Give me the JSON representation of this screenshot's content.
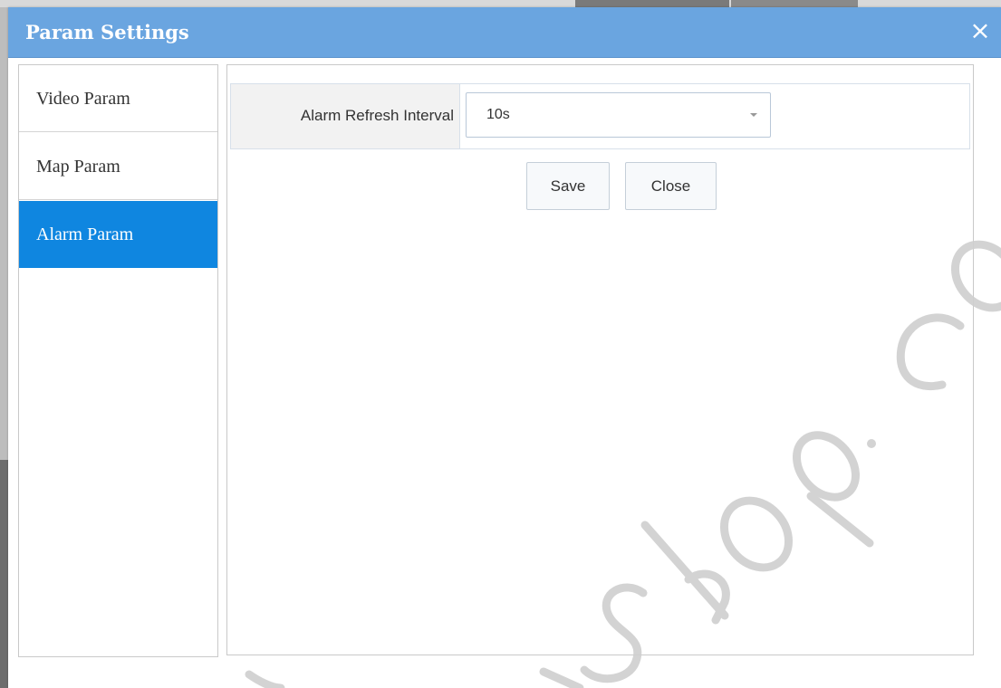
{
  "dialog": {
    "title": "Param Settings",
    "close_symbol": "×"
  },
  "sidebar": {
    "items": [
      {
        "label": "Video Param",
        "active": false
      },
      {
        "label": "Map Param",
        "active": false
      },
      {
        "label": "Alarm Param",
        "active": true
      }
    ]
  },
  "form": {
    "alarm_refresh_interval": {
      "label": "Alarm Refresh Interval",
      "value": "10s"
    }
  },
  "buttons": {
    "save_label": "Save",
    "close_label": "Close"
  },
  "colors": {
    "titlebar": "#6aa5e0",
    "active_item": "#0f86e0"
  }
}
